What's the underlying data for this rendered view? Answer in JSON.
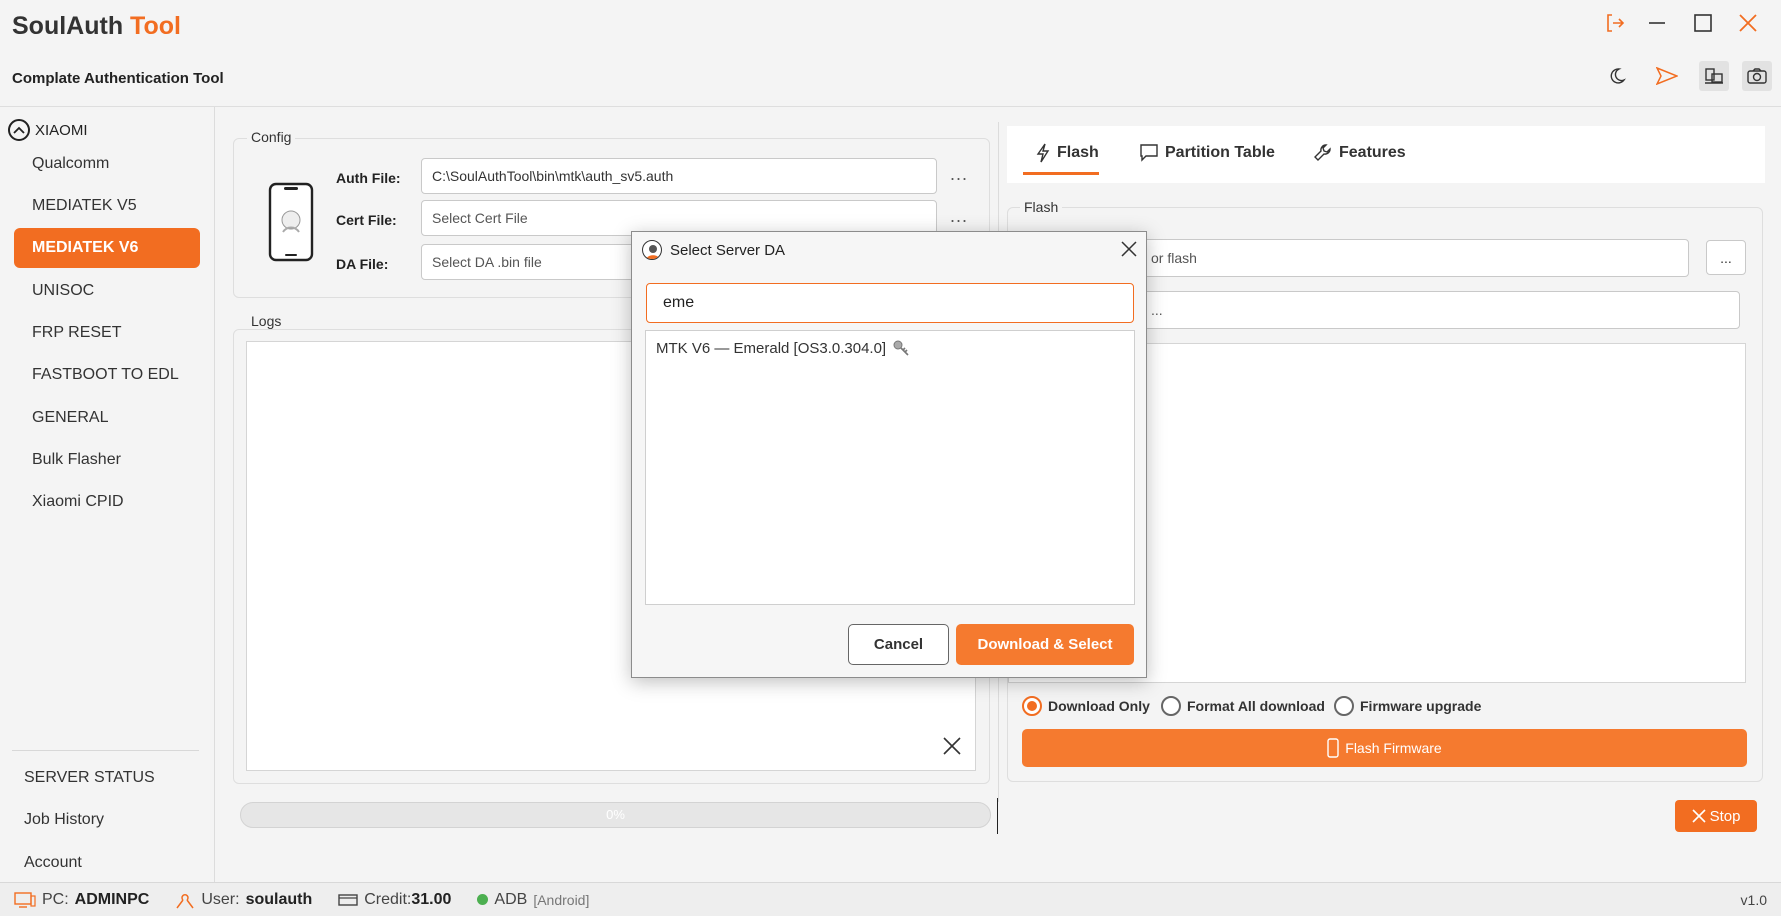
{
  "app": {
    "title_main": "SoulAuth",
    "title_accent": "Tool",
    "subtitle": "Complate Authentication Tool"
  },
  "sidebar": {
    "brand": "XIAOMI",
    "items": [
      {
        "label": "Qualcomm",
        "active": false
      },
      {
        "label": "MEDIATEK V5",
        "active": false
      },
      {
        "label": "MEDIATEK V6",
        "active": true
      },
      {
        "label": "UNISOC",
        "active": false
      },
      {
        "label": "FRP RESET",
        "active": false
      },
      {
        "label": "FASTBOOT TO EDL",
        "active": false
      },
      {
        "label": "GENERAL",
        "active": false
      },
      {
        "label": "Bulk Flasher",
        "active": false
      },
      {
        "label": "Xiaomi CPID",
        "active": false
      }
    ],
    "bottom": [
      "SERVER STATUS",
      "Job History",
      "Account"
    ]
  },
  "config": {
    "group_label": "Config",
    "auth_label": "Auth File:",
    "auth_value": "C:\\SoulAuthTool\\bin\\mtk\\auth_sv5.auth",
    "cert_label": "Cert File:",
    "cert_placeholder": "Select Cert File",
    "da_label": "DA File:",
    "da_placeholder": "Select DA .bin file",
    "browse": "..."
  },
  "logs": {
    "group_label": "Logs",
    "progress_text": "0%"
  },
  "right": {
    "tabs": [
      "Flash",
      "Partition Table",
      "Features"
    ],
    "group_label": "Flash",
    "firmware_placeholder_partial": "or flash",
    "scatter_partial": "...",
    "browse": "...",
    "radios": [
      {
        "label": "Download Only",
        "checked": true
      },
      {
        "label": "Format All download",
        "checked": false
      },
      {
        "label": "Firmware upgrade",
        "checked": false
      }
    ],
    "flash_button": "Flash Firmware",
    "stop_button": "Stop"
  },
  "status": {
    "pc_label": "PC:",
    "pc_value": "ADMINPC",
    "user_label": "User:",
    "user_value": "soulauth",
    "credit_label": "Credit:",
    "credit_value": "31.00",
    "adb_label": "ADB",
    "adb_mode": "[Android]",
    "version": "v1.0",
    "adb_color": "#4caf50"
  },
  "dialog": {
    "title": "Select Server DA",
    "search_value": "eme",
    "results": [
      "MTK V6 — Emerald [OS3.0.304.0]"
    ],
    "cancel": "Cancel",
    "primary": "Download & Select"
  },
  "colors": {
    "accent": "#f26d21"
  }
}
